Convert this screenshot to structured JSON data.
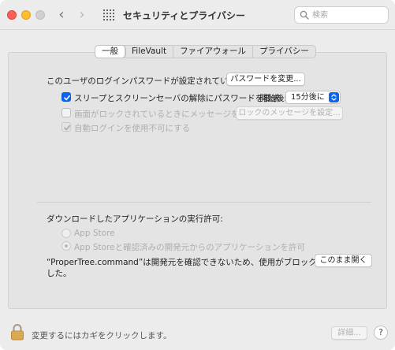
{
  "window": {
    "title": "セキュリティとプライバシー",
    "search_placeholder": "検索"
  },
  "tabs": [
    {
      "label": "一般",
      "active": true
    },
    {
      "label": "FileVault",
      "active": false
    },
    {
      "label": "ファイアウォール",
      "active": false
    },
    {
      "label": "プライバシー",
      "active": false
    }
  ],
  "general": {
    "login_password_text": "このユーザのログインパスワードが設定されています",
    "change_password_button": "パスワードを変更...",
    "require_password_label": "スリープとスクリーンセーバの解除にパスワードを要求",
    "require_password_checked": true,
    "start_after_label": "開始後:",
    "start_after_value": "15分後に",
    "show_message_label": "画面がロックされているときにメッセージを表示",
    "show_message_checked": false,
    "set_lock_message_button": "ロックのメッセージを設定...",
    "disable_auto_login_label": "自動ログインを使用不可にする",
    "disable_auto_login_checked": true
  },
  "downloads": {
    "heading": "ダウンロードしたアプリケーションの実行許可:",
    "options": [
      {
        "label": "App Store",
        "selected": false
      },
      {
        "label": "App Storeと確認済みの開発元からのアプリケーションを許可",
        "selected": true
      }
    ],
    "blocked_message_line1": "“ProperTree.command”は開発元を確認できないため、使用がブロックされま",
    "blocked_message_line2": "した。",
    "open_anyway_button": "このまま開く"
  },
  "footer": {
    "lock_text": "変更するにはカギをクリックします。",
    "advanced_button": "詳細...",
    "help_label": "?"
  },
  "colors": {
    "accent": "#0a66f0",
    "close": "#fe5f57",
    "minimize": "#febc2e"
  }
}
